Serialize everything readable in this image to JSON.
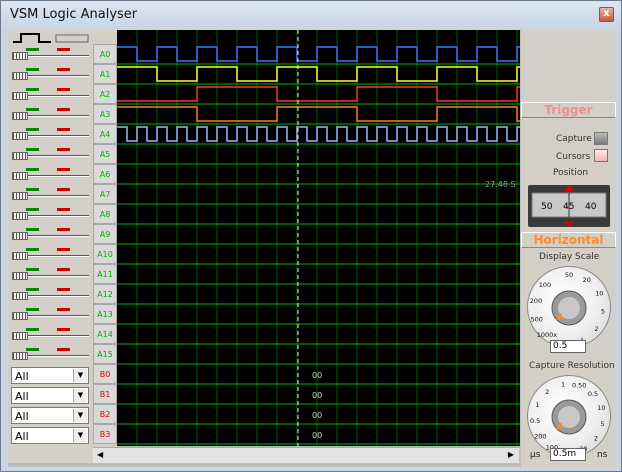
{
  "window": {
    "title": "VSM Logic Analyser",
    "close_glyph": "x"
  },
  "channels": [
    "A0",
    "A1",
    "A2",
    "A3",
    "A4",
    "A5",
    "A6",
    "A7",
    "A8",
    "A9",
    "A10",
    "A11",
    "A12",
    "A13",
    "A14",
    "A15"
  ],
  "bus_channels": [
    "B0",
    "B1",
    "B2",
    "B3"
  ],
  "bus_values": [
    "00",
    "00",
    "00",
    "00"
  ],
  "bus_selects": [
    "All",
    "All",
    "All",
    "All"
  ],
  "cursor": {
    "readout": "27.48 S"
  },
  "trigger": {
    "title": "Trigger",
    "capture_label": "Capture",
    "cursors_label": "Cursors",
    "position_label": "Position"
  },
  "position_knob": {
    "ticks": [
      "50",
      "45",
      "40"
    ]
  },
  "horizontal": {
    "title": "Horizontal",
    "display_scale_label": "Display Scale",
    "display_scale_ticks": [
      "50",
      "20",
      "10",
      "5",
      "2",
      "1",
      "1x",
      "1000x",
      "500",
      "200",
      "100"
    ],
    "display_scale_value": "0.5",
    "capture_resolution_label": "Capture Resolution",
    "capture_ticks": [
      "1",
      "0.50",
      "0.5",
      "10",
      "5",
      "2",
      "20",
      "50",
      "100",
      "200",
      "0.5",
      "1",
      "2"
    ],
    "capture_value": "0.5m",
    "unit_left": "µs",
    "unit_right": "ns"
  },
  "colors": {
    "A0": "#3c78ff",
    "A1": "#ffff33",
    "A2": "#ff3333",
    "A3": "#ff7a2a",
    "A4": "#9fb4ff",
    "grid": "#00a000",
    "bg": "#000000"
  }
}
